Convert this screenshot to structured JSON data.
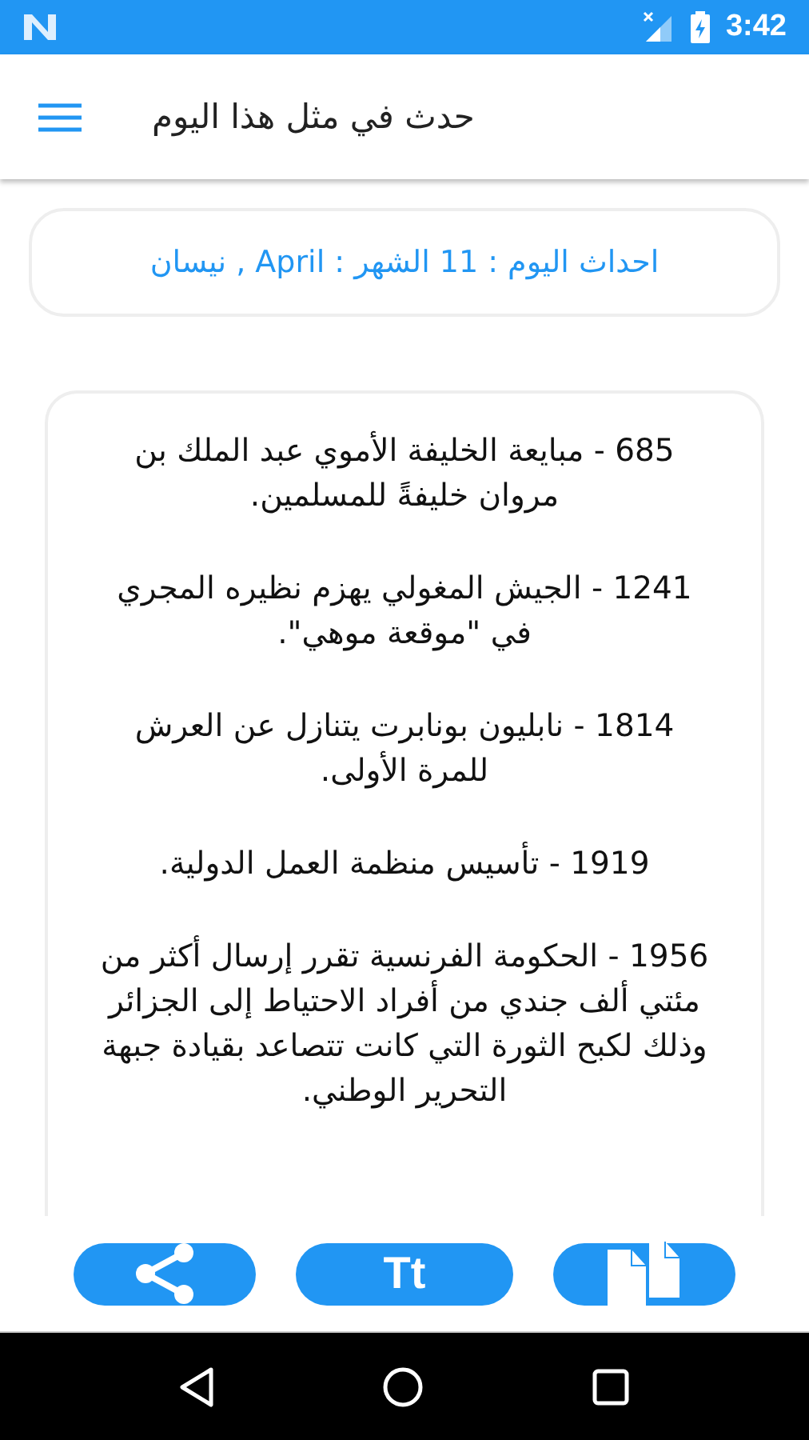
{
  "status_bar": {
    "time": "3:42"
  },
  "app_bar": {
    "title": "حدث في مثل هذا اليوم"
  },
  "date_card": {
    "text": "احداث اليوم : 11 الشهر : April , نيسان"
  },
  "events": [
    {
      "text": "685 - مبايعة الخليفة الأموي عبد الملك بن مروان خليفةً للمسلمين."
    },
    {
      "text": "1241 - الجيش المغولي يهزم نظيره المجري في \"موقعة موهي\"."
    },
    {
      "text": "1814 - نابليون بونابرت يتنازل عن العرش للمرة الأولى."
    },
    {
      "text": "1919 - تأسيس منظمة العمل الدولية."
    },
    {
      "text": "1956 - الحكومة الفرنسية تقرر إرسال أكثر من مئتي ألف جندي من أفراد الاحتياط إلى الجزائر وذلك لكبح الثورة التي كانت تتصاعد بقيادة جبهة التحرير الوطني."
    }
  ],
  "actions": [
    {
      "kind": "share"
    },
    {
      "kind": "text_size",
      "label": "Tt"
    },
    {
      "kind": "copy"
    }
  ]
}
